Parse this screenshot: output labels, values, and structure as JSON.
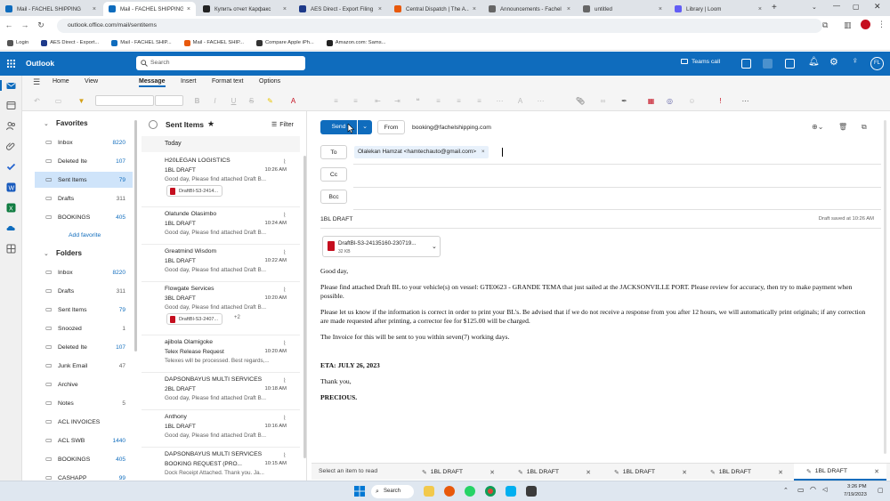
{
  "browser": {
    "tabs": [
      {
        "label": "Mail - FACHEL SHIPPING",
        "fav_color": "#0f6cbd",
        "active": false
      },
      {
        "label": "Mail - FACHEL SHIPPING",
        "fav_color": "#0f6cbd",
        "active": true
      },
      {
        "label": "Купить отчет Карфакс",
        "fav_color": "#222222",
        "active": false
      },
      {
        "label": "AES Direct - Export Filing",
        "fav_color": "#1e3a8a",
        "active": false
      },
      {
        "label": "Central Dispatch | The A...",
        "fav_color": "#e8590c",
        "active": false
      },
      {
        "label": "Announcements - Fachel",
        "fav_color": "#666666",
        "active": false
      },
      {
        "label": "untitled",
        "fav_color": "#666666",
        "active": false
      },
      {
        "label": "Library | Loom",
        "fav_color": "#625df5",
        "active": false
      }
    ],
    "url": "outlook.office.com/mail/sentitems",
    "profile_initial": "",
    "bookmarks": [
      {
        "label": "Login",
        "color": "#555555"
      },
      {
        "label": "AES Direct - Export...",
        "color": "#1e3a8a"
      },
      {
        "label": "Mail - FACHEL SHIP...",
        "color": "#0f6cbd"
      },
      {
        "label": "Mail - FACHEL SHIP...",
        "color": "#e8590c"
      },
      {
        "label": "Compare Apple iPh...",
        "color": "#333333"
      },
      {
        "label": "Amazon.com: Sams...",
        "color": "#222222"
      }
    ]
  },
  "outlook": {
    "app_name": "Outlook",
    "search_placeholder": "Search",
    "teams_call": "Teams call",
    "avatar": "FL",
    "ribbon_tabs": [
      "Home",
      "View",
      "Message",
      "Insert",
      "Format text",
      "Options"
    ],
    "active_ribbon_tab": "Message"
  },
  "folders": {
    "favorites_title": "Favorites",
    "favorites": [
      {
        "name": "Inbox",
        "count": "8220"
      },
      {
        "name": "Deleted Ite",
        "count": "107"
      },
      {
        "name": "Sent Items",
        "count": "79"
      },
      {
        "name": "Drafts",
        "count": "311"
      },
      {
        "name": "BOOKINGS",
        "count": "405"
      }
    ],
    "add_favorite": "Add favorite",
    "folders_title": "Folders",
    "items": [
      {
        "name": "Inbox",
        "count": "8220"
      },
      {
        "name": "Drafts",
        "count": "311"
      },
      {
        "name": "Sent Items",
        "count": "79"
      },
      {
        "name": "Snoozed",
        "count": "1"
      },
      {
        "name": "Deleted Ite",
        "count": "107"
      },
      {
        "name": "Junk Email",
        "count": "47"
      },
      {
        "name": "Archive",
        "count": ""
      },
      {
        "name": "Notes",
        "count": "5"
      },
      {
        "name": "ACL INVOICES",
        "count": ""
      },
      {
        "name": "ACL SWB",
        "count": "1440"
      },
      {
        "name": "BOOKINGS",
        "count": "405"
      },
      {
        "name": "CASHAPP",
        "count": "99"
      }
    ]
  },
  "message_list": {
    "title": "Sent Items",
    "filter": "Filter",
    "group": "Today",
    "items": [
      {
        "sender": "H20LEGAN LOGISTICS",
        "subject": "1BL DRAFT",
        "time": "10:26 AM",
        "preview": "Good day, Please find attached Draft B...",
        "attachment": "DraftBl-S3-2414...",
        "extra": ""
      },
      {
        "sender": "Olatunde Olasimbo",
        "subject": "1BL DRAFT",
        "time": "10:24 AM",
        "preview": "Good day, Please find attached Draft B...",
        "attachment": "",
        "extra": ""
      },
      {
        "sender": "Greatmind Wisdom",
        "subject": "1BL DRAFT",
        "time": "10:22 AM",
        "preview": "Good day, Please find attached Draft B...",
        "attachment": "",
        "extra": ""
      },
      {
        "sender": "Flowgate Services",
        "subject": "3BL DRAFT",
        "time": "10:20 AM",
        "preview": "Good day, Please find attached Draft B...",
        "attachment": "DraftBl-S3-2407...",
        "extra": "+2"
      },
      {
        "sender": "ajibola Olamigoke",
        "subject": "Telex Release Request",
        "time": "10:20 AM",
        "preview": "Telexes will be processed. Best regards,...",
        "attachment": "",
        "extra": ""
      },
      {
        "sender": "DAPSONBAYUS MULTI SERVICES",
        "subject": "2BL DRAFT",
        "time": "10:18 AM",
        "preview": "Good day, Please find attached Draft B...",
        "attachment": "",
        "extra": ""
      },
      {
        "sender": "Anthony",
        "subject": "1BL DRAFT",
        "time": "10:16 AM",
        "preview": "Good day, Please find attached Draft B...",
        "attachment": "",
        "extra": ""
      },
      {
        "sender": "DAPSONBAYUS MULTI SERVICES",
        "subject": "BOOKING REQUEST (PRO...",
        "time": "10:15 AM",
        "preview": "Dock Receipt Attached. Thank you. Ja...",
        "attachment": "",
        "extra": ""
      }
    ]
  },
  "compose": {
    "send": "Send",
    "from_label": "From",
    "from_value": "booking@fachelshipping.com",
    "to_label": "To",
    "to_recipient": "Olalekan Hamzat <hamtechauto@gmail.com>",
    "cc_label": "Cc",
    "bcc_label": "Bcc",
    "subject": "1BL DRAFT",
    "draft_saved": "Draft saved at 10:26 AM",
    "attachment_name": "DraftBl-S3-24135160-230719...",
    "attachment_size": "32 KB",
    "body": {
      "greeting": "Good day,",
      "p1": "Please find attached Draft BL to your vehicle(s) on vessel: GTE0623 - GRANDE TEMA that just sailed at the JACKSONVILLE PORT. Please review for accuracy, then try to make payment when possible.",
      "p2": "Please let us know if the information is correct in order to print your BL's. Be advised that if we do not receive a response from you after 12 hours, we will automatically print originals; if any correction are made requested after printing, a corrector fee for $125.00 will be charged.",
      "p3": "The Invoice for this will be sent to you within seven(7) working days.",
      "eta": "ETA: JULY 26, 2023",
      "thanks": "Thank you,",
      "signature": "PRECIOUS."
    }
  },
  "bottom_tabs": {
    "placeholder": "Select an item to read",
    "tabs": [
      "1BL DRAFT",
      "1BL DRAFT",
      "1BL DRAFT",
      "1BL DRAFT",
      "1BL DRAFT"
    ]
  },
  "taskbar": {
    "search": "Search",
    "time": "3:26 PM",
    "date": "7/19/2023"
  }
}
